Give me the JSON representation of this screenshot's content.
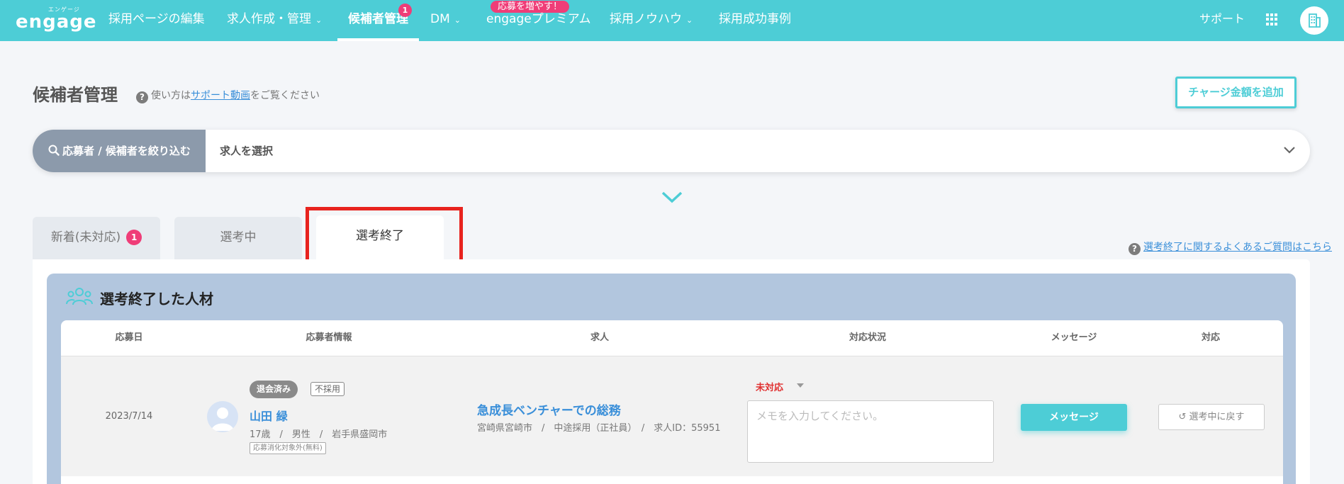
{
  "nav": {
    "logo_kana": "エンゲージ",
    "logo_word": "engage",
    "items": [
      {
        "label": "採用ページの編集"
      },
      {
        "label": "求人作成・管理",
        "chevron": "chevron-down-icon"
      },
      {
        "label": "候補者管理",
        "badge": "1",
        "active": true
      },
      {
        "label": "DM",
        "chevron": "chevron-down-icon"
      },
      {
        "label": "engageプレミアム",
        "promo": "応募を増やす！"
      },
      {
        "label": "採用ノウハウ",
        "chevron": "chevron-down-icon"
      },
      {
        "label": "採用成功事例"
      }
    ],
    "support": "サポート",
    "apps_icon": "grid-icon",
    "company_icon": "building-icon"
  },
  "page": {
    "title": "候補者管理",
    "help_prefix": "使い方は",
    "help_link": "サポート動画",
    "help_suffix": "をご覧ください",
    "charge_button": "チャージ金額を追加"
  },
  "filter": {
    "button_label": "応募者 / 候補者を絞り込む",
    "select_placeholder": "求人を選択"
  },
  "tabs": [
    {
      "label": "新着(未対応)",
      "badge": "1"
    },
    {
      "label": "選考中"
    },
    {
      "label": "選考終了",
      "selected": true
    }
  ],
  "faq_link": "選考終了に関するよくあるご質問はこちら",
  "panel": {
    "title": "選考終了した人材",
    "columns": [
      "応募日",
      "応募者情報",
      "求人",
      "対応状況",
      "メッセージ",
      "対応"
    ]
  },
  "row": {
    "date": "2023/7/14",
    "tag_status": "退会済み",
    "tag_result": "不採用",
    "name": "山田 緑",
    "meta": "17歳　/　男性　/　岩手県盛岡市",
    "small_tag": "応募消化対象外(無料)",
    "job_title": "急成長ベンチャーでの総務",
    "job_meta": "宮崎県宮崎市　/　中途採用（正社員）　/　求人ID：55951",
    "status": "未対応",
    "memo_placeholder": "メモを入力してください。",
    "message_button": "メッセージ",
    "back_button": "選考中に戻す"
  },
  "colors": {
    "brand": "#4dcdd6",
    "badge": "#ef3d78",
    "highlight": "#e8231e",
    "link": "#3a8fd9",
    "status_red": "#e02f2f"
  }
}
